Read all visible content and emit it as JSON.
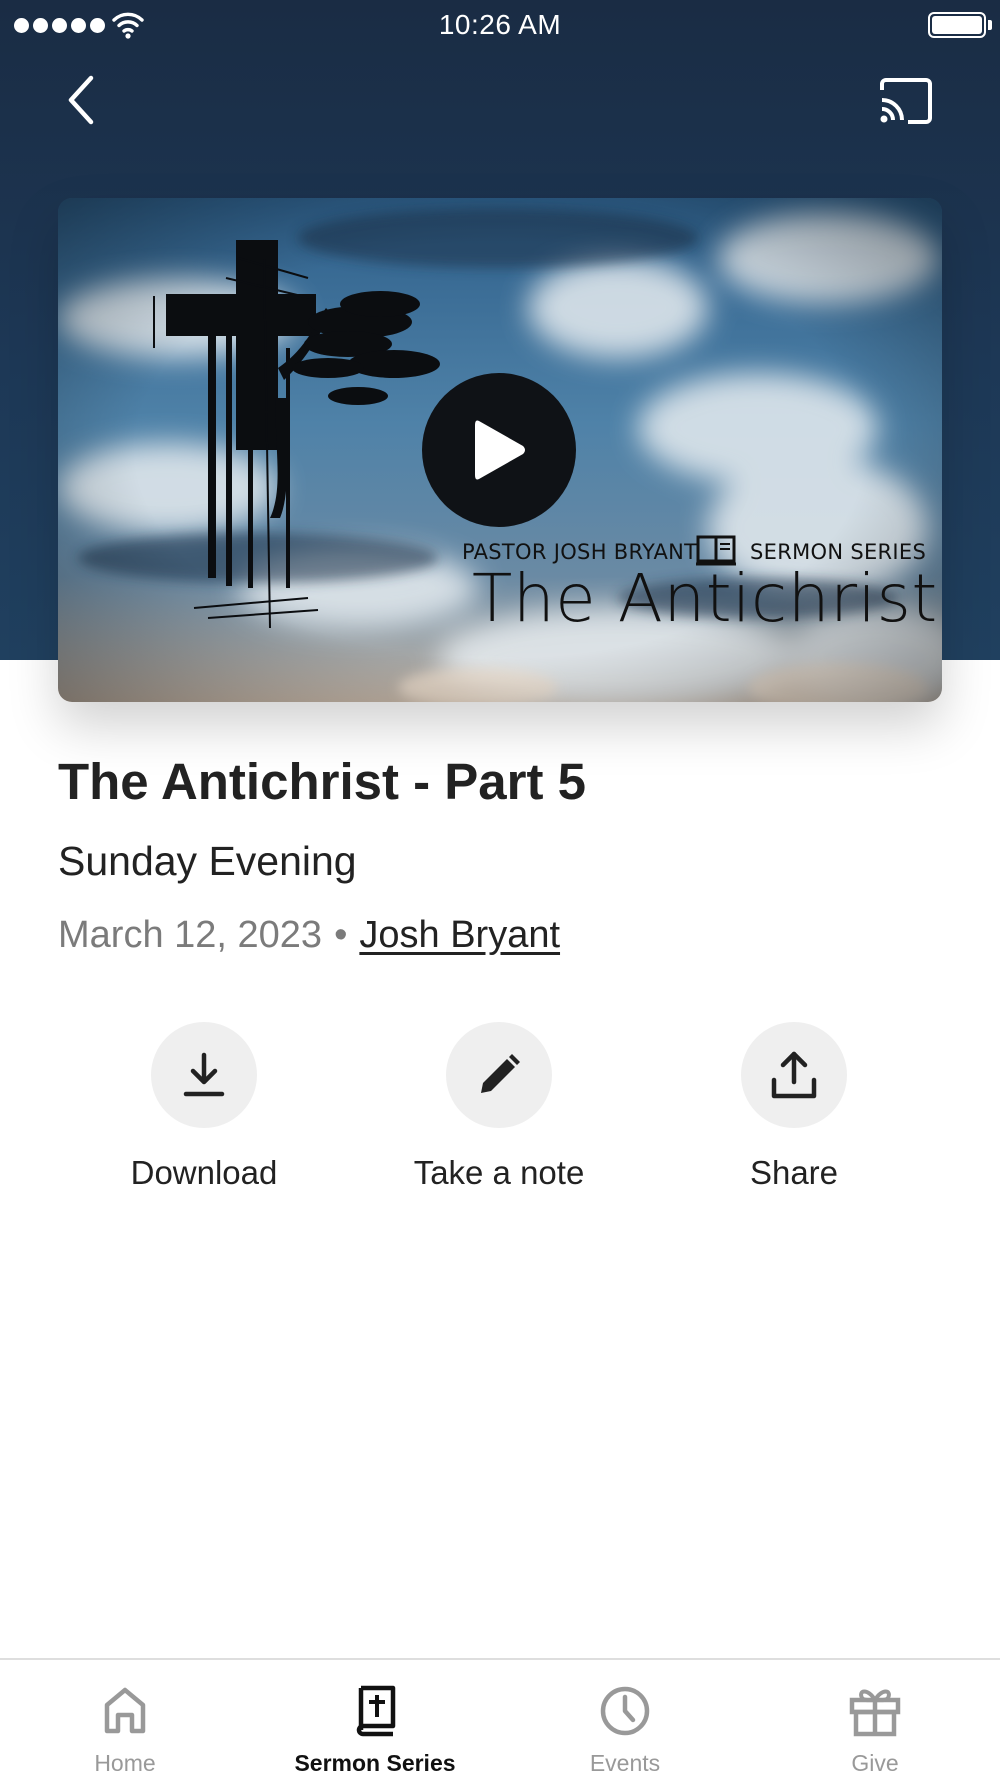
{
  "status_bar": {
    "time": "10:26 AM",
    "signal_icon": "signal-dots-icon",
    "wifi_icon": "wifi-icon",
    "battery_icon": "battery-icon"
  },
  "header": {
    "back_icon": "chevron-left-icon",
    "cast_icon": "cast-icon"
  },
  "artwork": {
    "pastor_text": "PASTOR JOSH BRYANT",
    "series_text": "SERMON SERIES",
    "title_text": "The Antichrist",
    "play_icon": "play-icon",
    "book_icon": "open-book-icon",
    "cross_image": "cross-with-tree-image"
  },
  "sermon": {
    "title": "The Antichrist - Part 5",
    "subtitle": "Sunday Evening",
    "date": "March 12, 2023",
    "separator": "•",
    "speaker": "Josh Bryant"
  },
  "actions": [
    {
      "label": "Download",
      "icon": "download-icon"
    },
    {
      "label": "Take a note",
      "icon": "pencil-icon"
    },
    {
      "label": "Share",
      "icon": "share-icon"
    }
  ],
  "tabs": [
    {
      "label": "Home",
      "icon": "home-icon",
      "active": false
    },
    {
      "label": "Sermon Series",
      "icon": "bible-icon",
      "active": true
    },
    {
      "label": "Events",
      "icon": "clock-icon",
      "active": false
    },
    {
      "label": "Give",
      "icon": "gift-icon",
      "active": false
    }
  ],
  "colors": {
    "header_background": "#1d3856",
    "text_primary": "#222222",
    "text_secondary": "#7b7b7b",
    "tab_inactive": "#999999",
    "action_circle": "#efefef"
  }
}
